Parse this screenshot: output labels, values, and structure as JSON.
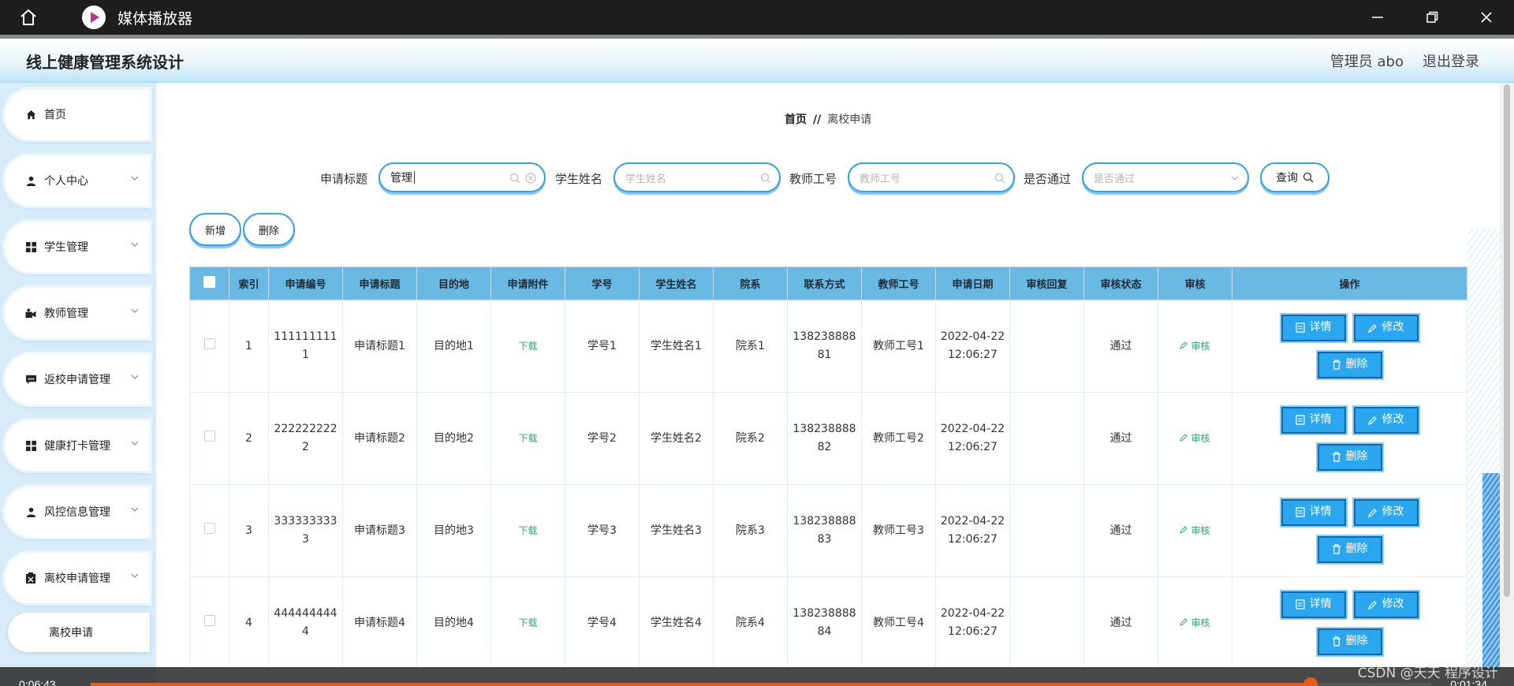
{
  "player": {
    "title": "媒体播放器",
    "home_icon": "home-icon",
    "logo_icon": "play-icon",
    "minimize_icon": "minimize-icon",
    "maximize_icon": "restore-icon",
    "close_icon": "close-icon"
  },
  "header": {
    "title": "线上健康管理系统设计",
    "user": "管理员 abo",
    "logout": "退出登录"
  },
  "sidebar": {
    "items": [
      {
        "label": "首页",
        "icon": "home-icon",
        "chevron": false
      },
      {
        "label": "个人中心",
        "icon": "user-icon",
        "chevron": true
      },
      {
        "label": "学生管理",
        "icon": "grid-icon",
        "chevron": true
      },
      {
        "label": "教师管理",
        "icon": "teacher-icon",
        "chevron": true
      },
      {
        "label": "返校申请管理",
        "icon": "chat-icon",
        "chevron": true
      },
      {
        "label": "健康打卡管理",
        "icon": "grid-icon",
        "chevron": true
      },
      {
        "label": "风控信息管理",
        "icon": "user-icon",
        "chevron": true
      },
      {
        "label": "离校申请管理",
        "icon": "clipboard-icon",
        "chevron": true
      }
    ],
    "sub_item": "离校申请"
  },
  "breadcrumb": {
    "home": "首页",
    "sep": "//",
    "current": "离校申请"
  },
  "search": {
    "title_label": "申请标题",
    "title_value": "管理",
    "student_label": "学生姓名",
    "student_placeholder": "学生姓名",
    "teacher_label": "教师工号",
    "teacher_placeholder": "教师工号",
    "pass_label": "是否通过",
    "pass_placeholder": "是否通过",
    "query": "查询"
  },
  "actions": {
    "add": "新增",
    "delete": "删除"
  },
  "table": {
    "headers": [
      "",
      "索引",
      "申请编号",
      "申请标题",
      "目的地",
      "申请附件",
      "学号",
      "学生姓名",
      "院系",
      "联系方式",
      "教师工号",
      "申请日期",
      "审核回复",
      "审核状态",
      "审核",
      "操作"
    ],
    "rows": [
      {
        "index": "1",
        "no": "1111111111",
        "title": "申请标题1",
        "dest": "目的地1",
        "attach": "下载",
        "sid": "学号1",
        "sname": "学生姓名1",
        "dept": "院系1",
        "phone": "13823888881",
        "tid": "教师工号1",
        "date": "2022-04-22 12:06:27",
        "reply": "",
        "status": "通过",
        "audit": "审核"
      },
      {
        "index": "2",
        "no": "2222222222",
        "title": "申请标题2",
        "dest": "目的地2",
        "attach": "下载",
        "sid": "学号2",
        "sname": "学生姓名2",
        "dept": "院系2",
        "phone": "13823888882",
        "tid": "教师工号2",
        "date": "2022-04-22 12:06:27",
        "reply": "",
        "status": "通过",
        "audit": "审核"
      },
      {
        "index": "3",
        "no": "3333333333",
        "title": "申请标题3",
        "dest": "目的地3",
        "attach": "下载",
        "sid": "学号3",
        "sname": "学生姓名3",
        "dept": "院系3",
        "phone": "13823888883",
        "tid": "教师工号3",
        "date": "2022-04-22 12:06:27",
        "reply": "",
        "status": "通过",
        "audit": "审核"
      },
      {
        "index": "4",
        "no": "4444444444",
        "title": "申请标题4",
        "dest": "目的地4",
        "attach": "下载",
        "sid": "学号4",
        "sname": "学生姓名4",
        "dept": "院系4",
        "phone": "13823888884",
        "tid": "教师工号4",
        "date": "2022-04-22 12:06:27",
        "reply": "",
        "status": "通过",
        "audit": "审核"
      }
    ],
    "op_detail": "详情",
    "op_edit": "修改",
    "op_delete": "删除"
  },
  "video": {
    "elapsed": "0:06:43",
    "remaining": "0:01:34",
    "progress": 0.91
  },
  "watermark": "CSDN @天天 程序设计",
  "colors": {
    "accent": "#2ba7f0",
    "header_row": "#6ab8e4",
    "link_green": "#29a86f",
    "progress": "#e05d1b"
  }
}
